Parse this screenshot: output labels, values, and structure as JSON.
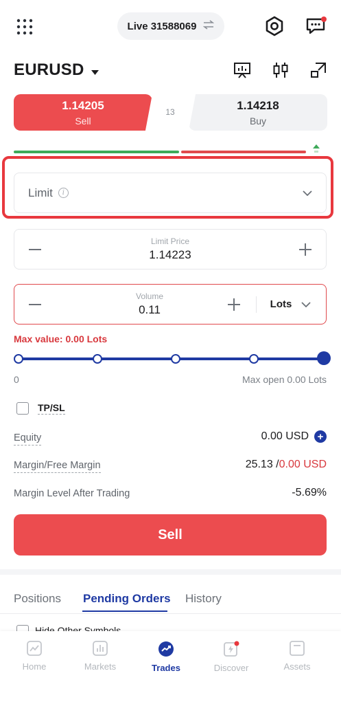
{
  "header": {
    "account_label": "Live 31588069"
  },
  "symbol": {
    "name": "EURUSD"
  },
  "quote": {
    "sell_price": "1.14205",
    "sell_label": "Sell",
    "buy_price": "1.14218",
    "buy_label": "Buy",
    "spread": "13"
  },
  "order_type": {
    "selected": "Limit"
  },
  "limit_price": {
    "caption": "Limit Price",
    "value": "1.14223"
  },
  "volume": {
    "caption": "Volume",
    "value": "0.11",
    "unit": "Lots"
  },
  "max_value_text": "Max value: 0.00 Lots",
  "slider": {
    "min_label": "0",
    "max_label": "Max open 0.00 Lots",
    "position_fraction": 1.0
  },
  "tpsl": {
    "label": "TP/SL",
    "checked": false
  },
  "account_info": {
    "equity_label": "Equity",
    "equity_value": "0.00 USD",
    "margin_label": "Margin/Free Margin",
    "margin_value": "25.13 /",
    "free_margin_value": "0.00 USD",
    "level_label": "Margin Level After Trading",
    "level_value": "-5.69%"
  },
  "sell_button_label": "Sell",
  "tabs": [
    {
      "label": "Positions"
    },
    {
      "label": "Pending Orders"
    },
    {
      "label": "History"
    }
  ],
  "hide_other_label": "Hide Other Symbols",
  "nav": [
    {
      "label": "Home",
      "icon": "home-chart-icon"
    },
    {
      "label": "Markets",
      "icon": "bar-chart-icon"
    },
    {
      "label": "Trades",
      "icon": "trend-icon"
    },
    {
      "label": "Discover",
      "icon": "flash-icon"
    },
    {
      "label": "Assets",
      "icon": "wallet-icon"
    }
  ],
  "colors": {
    "sell_red": "#ec4c4f",
    "accent_blue": "#1f3aa3",
    "error_red": "#d8383d",
    "buy_green": "#3faa5a"
  }
}
